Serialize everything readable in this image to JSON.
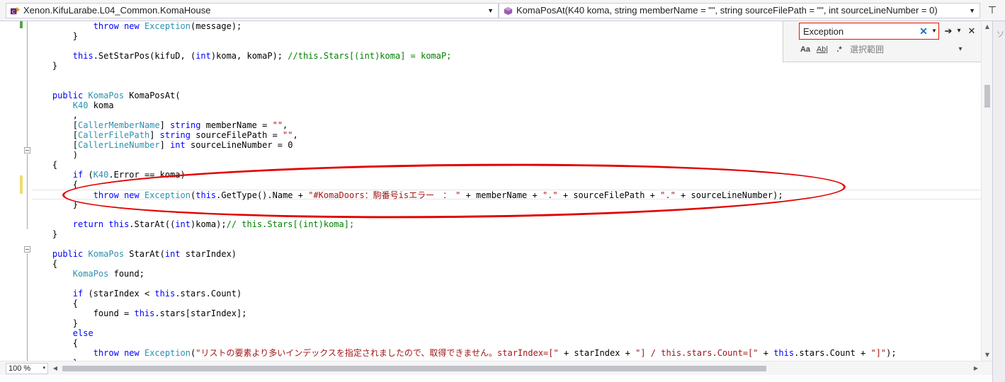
{
  "navbar": {
    "project_combo": "Xenon.KifuLarabe.L04_Common.KomaHouse",
    "member_combo": "KomaPosAt(K40 koma, string memberName = \"\", string sourceFilePath = \"\", int sourceLineNumber = 0)",
    "split_icon": "⊤"
  },
  "find": {
    "value": "Exception",
    "clear_glyph": "✕",
    "history_glyph": "▼",
    "next_glyph": "➔",
    "options_glyph": "▾",
    "close_glyph": "✕",
    "opt_case": "Aa",
    "opt_word": "Ab|",
    "opt_regex": ".*",
    "scope_label": "選択範囲",
    "scope_glyph": "▾"
  },
  "zoom": {
    "value": "100 %",
    "glyph": "▾"
  },
  "right_strip": {
    "text": "ソ"
  },
  "code_lines": [
    [
      [
        "plain",
        "            "
      ],
      [
        "kw",
        "throw"
      ],
      [
        "plain",
        " "
      ],
      [
        "kw",
        "new"
      ],
      [
        "plain",
        " "
      ],
      [
        "typ",
        "Exception"
      ],
      [
        "plain",
        "(message);"
      ]
    ],
    [
      [
        "plain",
        "        }"
      ]
    ],
    [],
    [
      [
        "plain",
        "        "
      ],
      [
        "kw",
        "this"
      ],
      [
        "plain",
        ".SetStarPos(kifuD, ("
      ],
      [
        "kw",
        "int"
      ],
      [
        "plain",
        ")koma, komaP); "
      ],
      [
        "com",
        "//this.Stars[(int)koma] = komaP;"
      ]
    ],
    [
      [
        "plain",
        "    }"
      ]
    ],
    [],
    [],
    [
      [
        "plain",
        "    "
      ],
      [
        "kw",
        "public"
      ],
      [
        "plain",
        " "
      ],
      [
        "typ",
        "KomaPos"
      ],
      [
        "plain",
        " KomaPosAt("
      ]
    ],
    [
      [
        "plain",
        "        "
      ],
      [
        "typ",
        "K40"
      ],
      [
        "plain",
        " koma"
      ]
    ],
    [
      [
        "plain",
        "        ,"
      ]
    ],
    [
      [
        "plain",
        "        ["
      ],
      [
        "typ",
        "CallerMemberName"
      ],
      [
        "plain",
        "] "
      ],
      [
        "kw",
        "string"
      ],
      [
        "plain",
        " memberName = "
      ],
      [
        "str",
        "\"\""
      ],
      [
        "plain",
        ","
      ]
    ],
    [
      [
        "plain",
        "        ["
      ],
      [
        "typ",
        "CallerFilePath"
      ],
      [
        "plain",
        "] "
      ],
      [
        "kw",
        "string"
      ],
      [
        "plain",
        " sourceFilePath = "
      ],
      [
        "str",
        "\"\""
      ],
      [
        "plain",
        ","
      ]
    ],
    [
      [
        "plain",
        "        ["
      ],
      [
        "typ",
        "CallerLineNumber"
      ],
      [
        "plain",
        "] "
      ],
      [
        "kw",
        "int"
      ],
      [
        "plain",
        " sourceLineNumber = 0"
      ]
    ],
    [
      [
        "plain",
        "        )"
      ]
    ],
    [
      [
        "plain",
        "    {"
      ]
    ],
    [
      [
        "plain",
        "        "
      ],
      [
        "kw",
        "if"
      ],
      [
        "plain",
        " ("
      ],
      [
        "typ",
        "K40"
      ],
      [
        "plain",
        ".Error == koma)"
      ]
    ],
    [
      [
        "plain",
        "        {"
      ]
    ],
    [
      [
        "plain",
        "            "
      ],
      [
        "kw",
        "throw"
      ],
      [
        "plain",
        " "
      ],
      [
        "kw",
        "new"
      ],
      [
        "plain",
        " "
      ],
      [
        "typ",
        "Exception"
      ],
      [
        "plain",
        "("
      ],
      [
        "kw",
        "this"
      ],
      [
        "plain",
        ".GetType().Name + "
      ],
      [
        "str",
        "\"#KomaDoors：駒番号isエラー　：　\""
      ],
      [
        "plain",
        " + memberName + "
      ],
      [
        "str",
        "\".\""
      ],
      [
        "plain",
        " + sourceFilePath + "
      ],
      [
        "str",
        "\".\""
      ],
      [
        "plain",
        " + sourceLineNumber);"
      ]
    ],
    [
      [
        "plain",
        "        }"
      ]
    ],
    [],
    [
      [
        "plain",
        "        "
      ],
      [
        "kw",
        "return"
      ],
      [
        "plain",
        " "
      ],
      [
        "kw",
        "this"
      ],
      [
        "plain",
        ".StarAt(("
      ],
      [
        "kw",
        "int"
      ],
      [
        "plain",
        ")koma);"
      ],
      [
        "com",
        "// this.Stars[(int)koma];"
      ]
    ],
    [
      [
        "plain",
        "    }"
      ]
    ],
    [],
    [
      [
        "plain",
        "    "
      ],
      [
        "kw",
        "public"
      ],
      [
        "plain",
        " "
      ],
      [
        "typ",
        "KomaPos"
      ],
      [
        "plain",
        " StarAt("
      ],
      [
        "kw",
        "int"
      ],
      [
        "plain",
        " starIndex)"
      ]
    ],
    [
      [
        "plain",
        "    {"
      ]
    ],
    [
      [
        "plain",
        "        "
      ],
      [
        "typ",
        "KomaPos"
      ],
      [
        "plain",
        " found;"
      ]
    ],
    [],
    [
      [
        "plain",
        "        "
      ],
      [
        "kw",
        "if"
      ],
      [
        "plain",
        " (starIndex < "
      ],
      [
        "kw",
        "this"
      ],
      [
        "plain",
        ".stars.Count)"
      ]
    ],
    [
      [
        "plain",
        "        {"
      ]
    ],
    [
      [
        "plain",
        "            found = "
      ],
      [
        "kw",
        "this"
      ],
      [
        "plain",
        ".stars[starIndex];"
      ]
    ],
    [
      [
        "plain",
        "        }"
      ]
    ],
    [
      [
        "plain",
        "        "
      ],
      [
        "kw",
        "else"
      ]
    ],
    [
      [
        "plain",
        "        {"
      ]
    ],
    [
      [
        "plain",
        "            "
      ],
      [
        "kw",
        "throw"
      ],
      [
        "plain",
        " "
      ],
      [
        "kw",
        "new"
      ],
      [
        "plain",
        " "
      ],
      [
        "typ",
        "Exception"
      ],
      [
        "plain",
        "("
      ],
      [
        "str",
        "\"リストの要素より多いインデックスを指定されましたので、取得できません。starIndex=[\""
      ],
      [
        "plain",
        " + starIndex + "
      ],
      [
        "str",
        "\"] / this.stars.Count=[\""
      ],
      [
        "plain",
        " + "
      ],
      [
        "kw",
        "this"
      ],
      [
        "plain",
        ".stars.Count + "
      ],
      [
        "str",
        "\"]\""
      ],
      [
        "plain",
        ");"
      ]
    ],
    [
      [
        "plain",
        "        }"
      ]
    ]
  ],
  "colors": {
    "keyword": "#0000ff",
    "type": "#2b91af",
    "string": "#a31515",
    "comment": "#008000",
    "annotation": "#e20000",
    "change_saved": "#57a64a",
    "change_unsaved": "#efdc6b"
  }
}
